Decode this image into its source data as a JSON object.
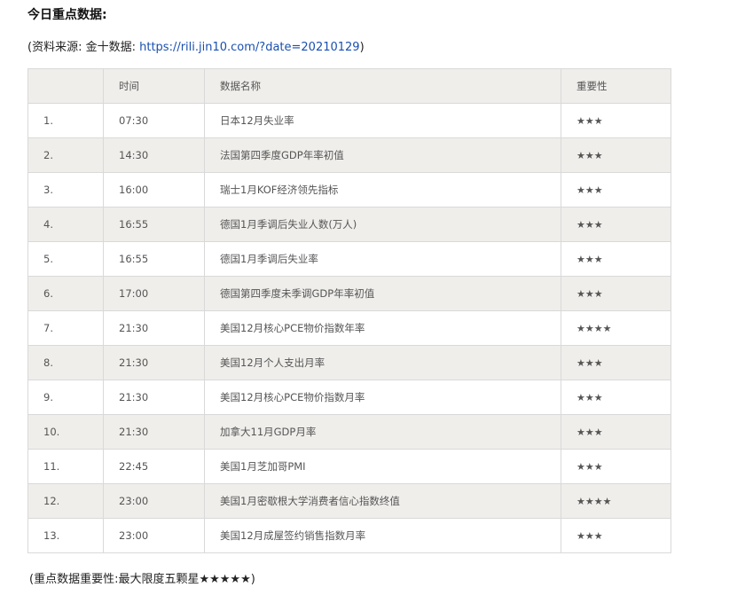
{
  "heading": "今日重点数据:",
  "source": {
    "prefix": "(资料来源: 金十数据: ",
    "link_text": "https://rili.jin10.com/?date=20210129",
    "suffix": ")"
  },
  "table": {
    "headers": [
      "",
      "时间",
      "数据名称",
      "重要性"
    ],
    "rows": [
      {
        "index": "1.",
        "time": "07:30",
        "name": "日本12月失业率",
        "importance": "★★★"
      },
      {
        "index": "2.",
        "time": "14:30",
        "name": "法国第四季度GDP年率初值",
        "importance": "★★★"
      },
      {
        "index": "3.",
        "time": "16:00",
        "name": "瑞士1月KOF经济领先指标",
        "importance": "★★★"
      },
      {
        "index": "4.",
        "time": "16:55",
        "name": "德国1月季调后失业人数(万人)",
        "importance": "★★★"
      },
      {
        "index": "5.",
        "time": "16:55",
        "name": "德国1月季调后失业率",
        "importance": "★★★"
      },
      {
        "index": "6.",
        "time": "17:00",
        "name": "德国第四季度未季调GDP年率初值",
        "importance": "★★★"
      },
      {
        "index": "7.",
        "time": "21:30",
        "name": "美国12月核心PCE物价指数年率",
        "importance": "★★★★"
      },
      {
        "index": "8.",
        "time": "21:30",
        "name": "美国12月个人支出月率",
        "importance": "★★★"
      },
      {
        "index": "9.",
        "time": "21:30",
        "name": "美国12月核心PCE物价指数月率",
        "importance": "★★★"
      },
      {
        "index": "10.",
        "time": "21:30",
        "name": "加拿大11月GDP月率",
        "importance": "★★★"
      },
      {
        "index": "11.",
        "time": "22:45",
        "name": "美国1月芝加哥PMI",
        "importance": "★★★"
      },
      {
        "index": "12.",
        "time": "23:00",
        "name": "美国1月密歇根大学消费者信心指数终值",
        "importance": "★★★★"
      },
      {
        "index": "13.",
        "time": "23:00",
        "name": "美国12月成屋签约销售指数月率",
        "importance": "★★★"
      }
    ]
  },
  "footnote": "(重点数据重要性:最大限度五颗星★★★★★)"
}
